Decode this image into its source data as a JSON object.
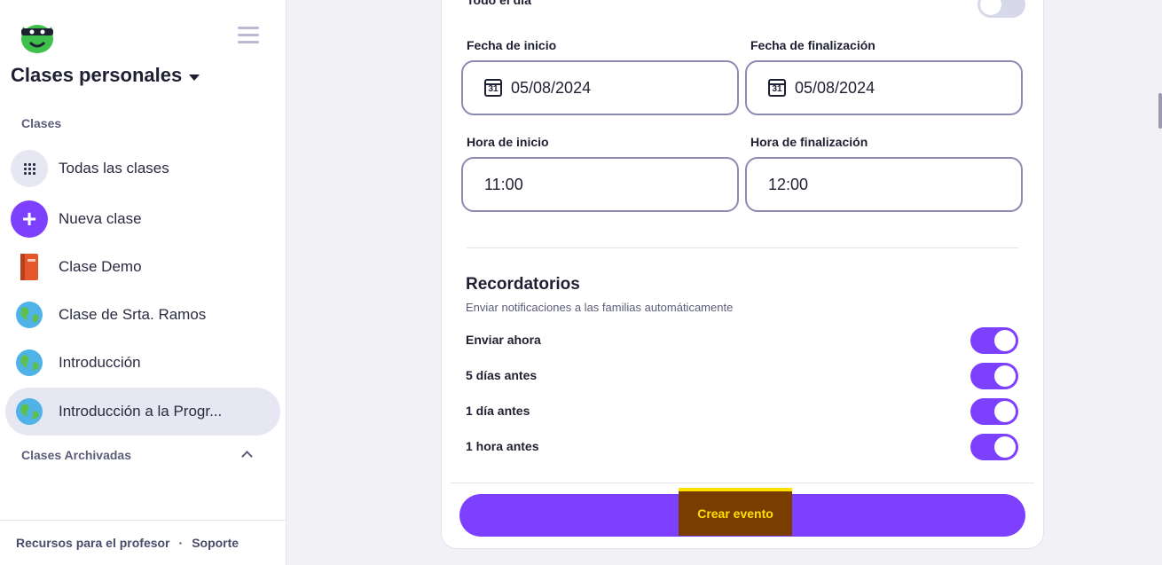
{
  "sidebar": {
    "switcher_label": "Clases personales",
    "classes_section": "Clases",
    "items": [
      {
        "label": "Todas las clases",
        "icon": "grid-icon"
      },
      {
        "label": "Nueva clase",
        "icon": "plus-icon"
      },
      {
        "label": "Clase Demo",
        "icon": "book-icon"
      },
      {
        "label": "Clase de Srta. Ramos",
        "icon": "globe-icon"
      },
      {
        "label": "Introducción",
        "icon": "globe-icon"
      },
      {
        "label": "Introducción a la Progr...",
        "icon": "globe-icon",
        "active": true
      }
    ],
    "archived_section": "Clases Archivadas",
    "footer": {
      "resources": "Recursos para el profesor",
      "separator": "·",
      "support": "Soporte"
    }
  },
  "form": {
    "all_day_label": "Todo el día",
    "all_day_enabled": false,
    "start_date_label": "Fecha de inicio",
    "start_date_value": "05/08/2024",
    "end_date_label": "Fecha de finalización",
    "end_date_value": "05/08/2024",
    "start_time_label": "Hora de inicio",
    "start_time_value": "11:00",
    "end_time_label": "Hora de finalización",
    "end_time_value": "12:00",
    "calendar_icon_text": "31"
  },
  "reminders": {
    "title": "Recordatorios",
    "subtitle": "Enviar notificaciones a las familias automáticamente",
    "options": [
      {
        "label": "Enviar ahora",
        "enabled": true
      },
      {
        "label": "5 días antes",
        "enabled": true
      },
      {
        "label": "1 día antes",
        "enabled": true
      },
      {
        "label": "1 hora antes",
        "enabled": true
      }
    ]
  },
  "actions": {
    "create_label": "Crear evento"
  },
  "colors": {
    "accent": "#7d40ff",
    "highlight_bg": "#7a3d00",
    "highlight_text": "#ffe100"
  }
}
